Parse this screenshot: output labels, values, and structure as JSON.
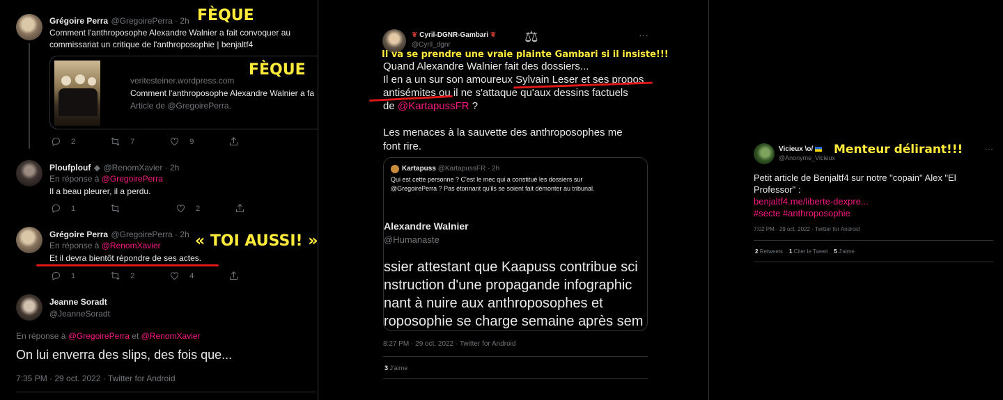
{
  "left": {
    "tweet1": {
      "name": "Grégoire Perra",
      "handle_time": "@GregoirePerra · 2h",
      "text_line1": "Comment l'anthroposophe Alexandre Walnier a fait convoquer au",
      "text_line2": "commissariat un critique de l'anthroposophie | benjaltf4",
      "card_domain": "veritesteiner.wordpress.com",
      "card_title": "Comment l'anthroposophe Alexandre Walnier a fa",
      "card_sub": "Article de @GregoirePerra.",
      "replies": "2",
      "retweets": "7",
      "likes": "9",
      "annotation1": "FÈQUE",
      "annotation2": "FÈQUE"
    },
    "tweet2": {
      "name": "Ploufplouf",
      "handle_time": "@RenomXavier · 2h",
      "reply_prefix": "En réponse à",
      "reply_to": "@GregoirePerra",
      "text": "Il a beau pleurer, il a perdu.",
      "replies": "1",
      "retweets": "",
      "likes": "2"
    },
    "tweet3": {
      "name": "Grégoire Perra",
      "handle_time": "@GregoirePerra · 2h",
      "reply_prefix": "En réponse à",
      "reply_to": "@RenomXavier",
      "text": "Et il devra bientôt répondre de ses actes.",
      "replies": "1",
      "retweets": "2",
      "likes": "4",
      "annotation": "« TOI AUSSI! »"
    },
    "tweet4": {
      "name": "Jeanne Soradt",
      "handle": "@JeanneSoradt",
      "reply_prefix": "En réponse à",
      "reply_to1": "@GregoirePerra",
      "reply_and": "et",
      "reply_to2": "@RenomXavier",
      "text": "On lui enverra des slips, des fois que...",
      "meta": "7:35 PM · 29 oct. 2022 · Twitter for Android"
    }
  },
  "middle": {
    "name": "Cyril-DGNR-Gambari",
    "handle": "@Cyril_dgnr",
    "more": "···",
    "annotation": "Il va se prendre une vraie plainte Gambari si il insiste!!!",
    "line1": "Quand Alexandre Walnier fait des dossiers...",
    "line2": "Il en a un sur son amoureux Sylvain Leser et ses propos",
    "line3a": "antisémites ou il ne s'attaque qu'aux dessins factuels",
    "line4_prefix": "de",
    "line4_mention": "@KartapussFR",
    "line4_suffix": "?",
    "line5": "Les menaces à la sauvette des anthroposophes me",
    "line6": "font rire.",
    "quote": {
      "name": "Kartapuss",
      "handle_time": "@KartapussFR · 2h",
      "text1": "Qui est cette personne ? C'est le mec qui a constitué les dossiers sur",
      "text2": "@GregoirePerra ? Pas étonnant qu'ils se soient fait démonter au tribunal.",
      "inner_name": "Alexandre Walnier",
      "inner_handle": "@Humanaste",
      "big1": "ssier attestant que Kaapuss contribue sci",
      "big2": "nstruction d'une propagande infographic",
      "big3": "nant à nuire aux anthroposophes et",
      "big4": "roposophie se charge semaine après sem"
    },
    "meta": "8:27 PM · 29 oct. 2022 · Twitter for Android",
    "likes_count": "3",
    "likes_label": "J'aime"
  },
  "right": {
    "name": "Vicieux \\o/",
    "handle": "@Anonyme_Vicieux",
    "more": "···",
    "annotation": "Menteur délirant!!!",
    "text1": "Petit article de Benjaltf4 sur notre \"copain\" Alex \"El",
    "text2": "Professor\" :",
    "link": "benjaltf4.me/liberte-dexpre...",
    "tags": "#secte #anthroposophie",
    "meta": "7:02 PM · 29 oct. 2022 · Twitter for Android",
    "retweets_count": "2",
    "retweets_label": "Retweets",
    "quotes_count": "1",
    "quotes_label": "Citer le Tweet",
    "likes_count": "5",
    "likes_label": "J'aime"
  },
  "colors": {
    "background": "#000000",
    "text": "#e7e9ea",
    "muted": "#71767b",
    "mention": "#f91880",
    "annotation": "#ffeb3b",
    "underline": "#e01818"
  }
}
